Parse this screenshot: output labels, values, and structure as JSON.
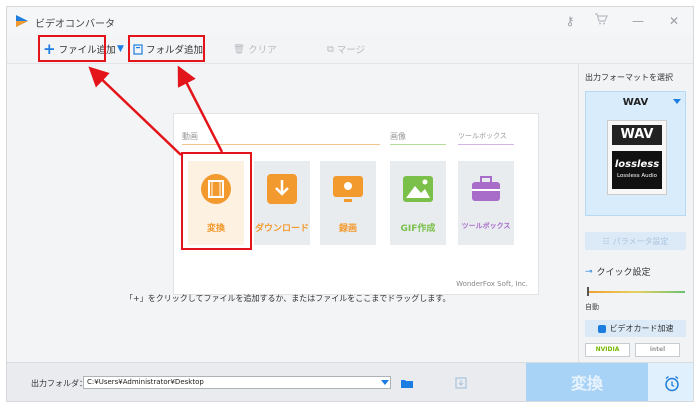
{
  "window": {
    "title": "ビデオコンバータ"
  },
  "toolbar": {
    "add_file": "ファイル追加",
    "add_folder": "フォルダ追加",
    "clear": "クリア",
    "merge": "マージ"
  },
  "screenshot": {
    "categories": [
      "動画",
      "画像",
      "ツールボックス"
    ],
    "tiles": [
      {
        "label": "変換",
        "color": "#f39a2e"
      },
      {
        "label": "ダウンロード",
        "color": "#f39a2e"
      },
      {
        "label": "録画",
        "color": "#f39a2e"
      },
      {
        "label": "GIF作成",
        "color": "#7ac04a"
      },
      {
        "label": "ツールボックス",
        "color": "#a86cc9"
      }
    ],
    "brand": "WonderFox Soft, Inc."
  },
  "hint": "「+」をクリックしてファイルを追加するか、またはファイルをここまでドラッグします。",
  "right_panel": {
    "title": "出力フォーマットを選択",
    "format": "WAV",
    "format_badge_top": "WAV",
    "format_badge_mid": "lossless",
    "format_badge_bot": "Lossless Audio",
    "param_button": "パラメータ設定",
    "quick_setting": "クイック設定",
    "auto_label": "自動",
    "gpu_button": "ビデオカード加速",
    "nvidia": "NVIDIA",
    "intel": "intel"
  },
  "bottom": {
    "output_label": "出力フォルダ：",
    "output_path": "C:¥Users¥Administrator¥Desktop",
    "convert_button": "変換"
  },
  "colors": {
    "accent": "#1e7de0",
    "annotation": "#e3151a"
  }
}
